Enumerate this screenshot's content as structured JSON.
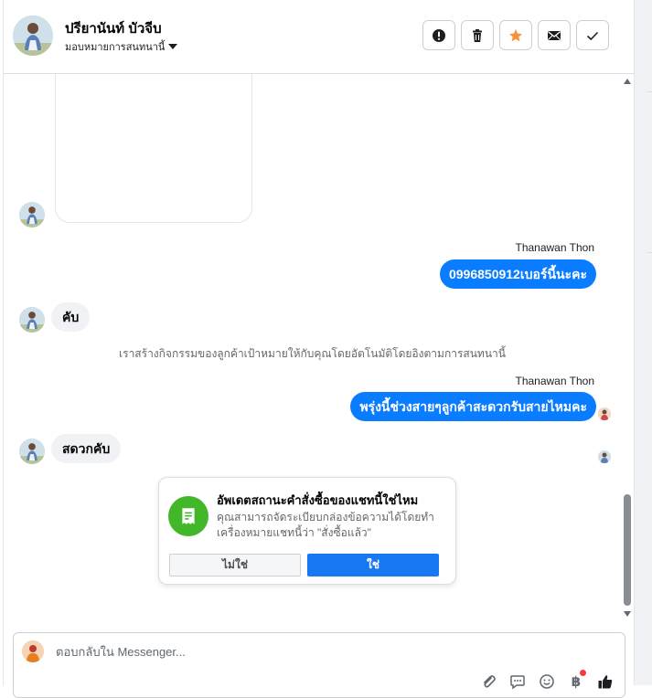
{
  "header": {
    "contact_name": "ปรียานันท์ บัวจีบ",
    "assign_label": "มอบหมายการสนทนานี้",
    "actions": [
      {
        "name": "spam-button",
        "icon": "alert-icon"
      },
      {
        "name": "delete-button",
        "icon": "trash-icon"
      },
      {
        "name": "star-button",
        "icon": "star-icon",
        "color": "#f7923b"
      },
      {
        "name": "mark-unread-button",
        "icon": "envelope-icon"
      },
      {
        "name": "mark-done-button",
        "icon": "check-icon"
      }
    ]
  },
  "thread": {
    "messages": [
      {
        "direction": "out",
        "sender": "Thanawan Thon",
        "text": "0996850912เบอร์นี้นะคะ"
      },
      {
        "direction": "in",
        "text": "คับ"
      },
      {
        "type": "system",
        "text": "เราสร้างกิจกรรมของลูกค้าเป้าหมายให้กับคุณโดยอัตโนมัติโดยอิงตามการสนทนานี้"
      },
      {
        "direction": "out",
        "sender": "Thanawan Thon",
        "text": "พรุ่งนี้ช่วงสายๆลูกค้าสะดวกรับสายไหมคะ"
      },
      {
        "direction": "in",
        "text": "สดวกคับ"
      }
    ]
  },
  "order_card": {
    "title": "อัพเดตสถานะคำสั่งซื้อของแชทนี้ใช่ไหม",
    "description": "คุณสามารถจัดระเบียบกล่องข้อความได้โดยทำเครื่องหมายแชทนี้ว่า \"สั่งซื้อแล้ว\"",
    "no_label": "ไม่ใช่",
    "yes_label": "ใช่",
    "icon": "receipt-icon",
    "icon_color": "#42b72a"
  },
  "composer": {
    "placeholder": "ตอบกลับใน Messenger...",
    "value": "",
    "tools": [
      "attachment-icon",
      "saved-replies-icon",
      "emoji-icon",
      "payment-icon",
      "like-icon"
    ],
    "payment_symbol": "฿"
  },
  "colors": {
    "outgoing_bubble": "#0a7cff",
    "primary_button": "#1877f2"
  }
}
